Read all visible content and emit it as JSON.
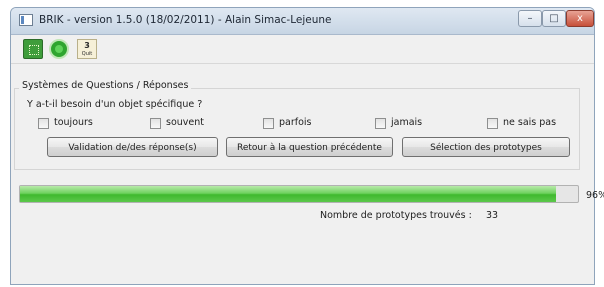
{
  "window": {
    "title": "BRIK - version 1.5.0 (18/02/2011) - Alain Simac-Lejeune",
    "controls": {
      "minimize": "–",
      "maximize": "□",
      "close": "x"
    }
  },
  "toolbar": {
    "buttons": [
      {
        "icon": "grid-icon"
      },
      {
        "icon": "run-icon"
      },
      {
        "icon": "quit-icon",
        "number": "3",
        "caption": "Quit"
      }
    ]
  },
  "questions_panel": {
    "title": "Systèmes de Questions / Réponses",
    "question": "Y a-t-il besoin d'un objet spécifique ?",
    "options": [
      {
        "label": "toujours",
        "checked": false
      },
      {
        "label": "souvent",
        "checked": false
      },
      {
        "label": "parfois",
        "checked": false
      },
      {
        "label": "jamais",
        "checked": false
      },
      {
        "label": "ne sais pas",
        "checked": false
      }
    ],
    "buttons": {
      "validate": "Validation de/des réponse(s)",
      "previous": "Retour à la question précédente",
      "select": "Sélection des prototypes"
    }
  },
  "progress": {
    "value": 96,
    "label": "96%"
  },
  "result": {
    "label": "Nombre de prototypes trouvés :",
    "value": "33"
  }
}
